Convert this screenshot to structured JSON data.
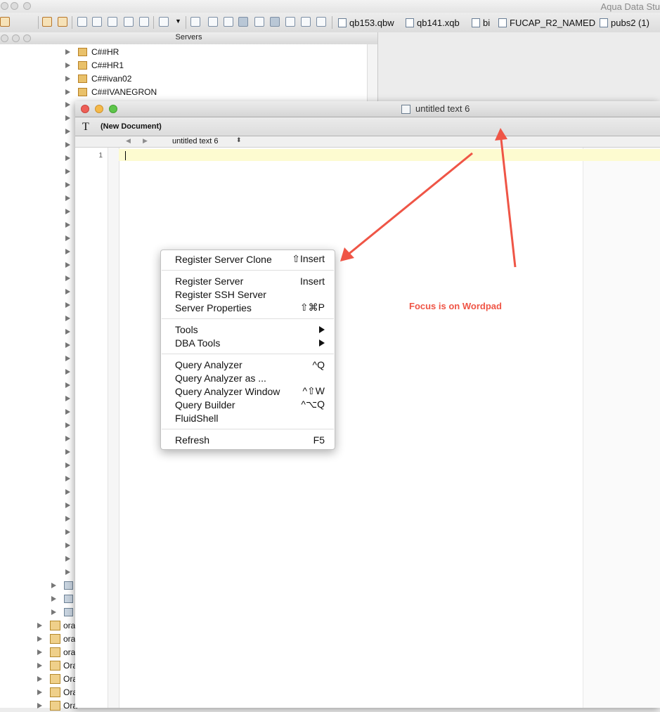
{
  "app": {
    "title": "Aqua Data Stu",
    "servers_panel_title": "Servers",
    "file_tabs": [
      "qb153.qbw",
      "qb141.xqb",
      "bi",
      "FUCAP_R2_NAMED",
      "pubs2 (1)"
    ]
  },
  "tree": {
    "top_nodes": [
      "C##HR",
      "C##HR1",
      "C##ivan02",
      "C##IVANEGRON"
    ],
    "bottom_nodes": [
      "ora",
      "ora",
      "ora",
      "Ora",
      "Ora",
      "Ora",
      "Ora"
    ]
  },
  "document": {
    "window_title": "untitled text 6",
    "toolbar_font_icon": "T",
    "toolbar_label": "(New Document)",
    "nav_doc_name": "untitled text 6",
    "line_number": "1"
  },
  "context_menu": {
    "items": [
      {
        "label": "Register Server Clone",
        "shortcut": "⇧Insert"
      },
      {
        "label": "Register Server",
        "shortcut": "Insert"
      },
      {
        "label": "Register SSH Server",
        "shortcut": ""
      },
      {
        "label": "Server Properties",
        "shortcut": "⇧⌘P"
      },
      {
        "label": "Tools",
        "shortcut": "",
        "submenu": true
      },
      {
        "label": "DBA Tools",
        "shortcut": "",
        "submenu": true
      },
      {
        "label": "Query Analyzer",
        "shortcut": "^Q"
      },
      {
        "label": "Query Analyzer as ...",
        "shortcut": ""
      },
      {
        "label": "Query Analyzer Window",
        "shortcut": "^⇧W"
      },
      {
        "label": "Query Builder",
        "shortcut": "^⌥Q"
      },
      {
        "label": "FluidShell",
        "shortcut": ""
      },
      {
        "label": "Refresh",
        "shortcut": "F5"
      }
    ]
  },
  "annotation": {
    "text": "Focus is on Wordpad",
    "color": "#ef5546"
  },
  "icons": {
    "server": "server-icon",
    "database": "database-icon",
    "oracle": "oracle-server-icon",
    "document": "text-document-icon"
  }
}
